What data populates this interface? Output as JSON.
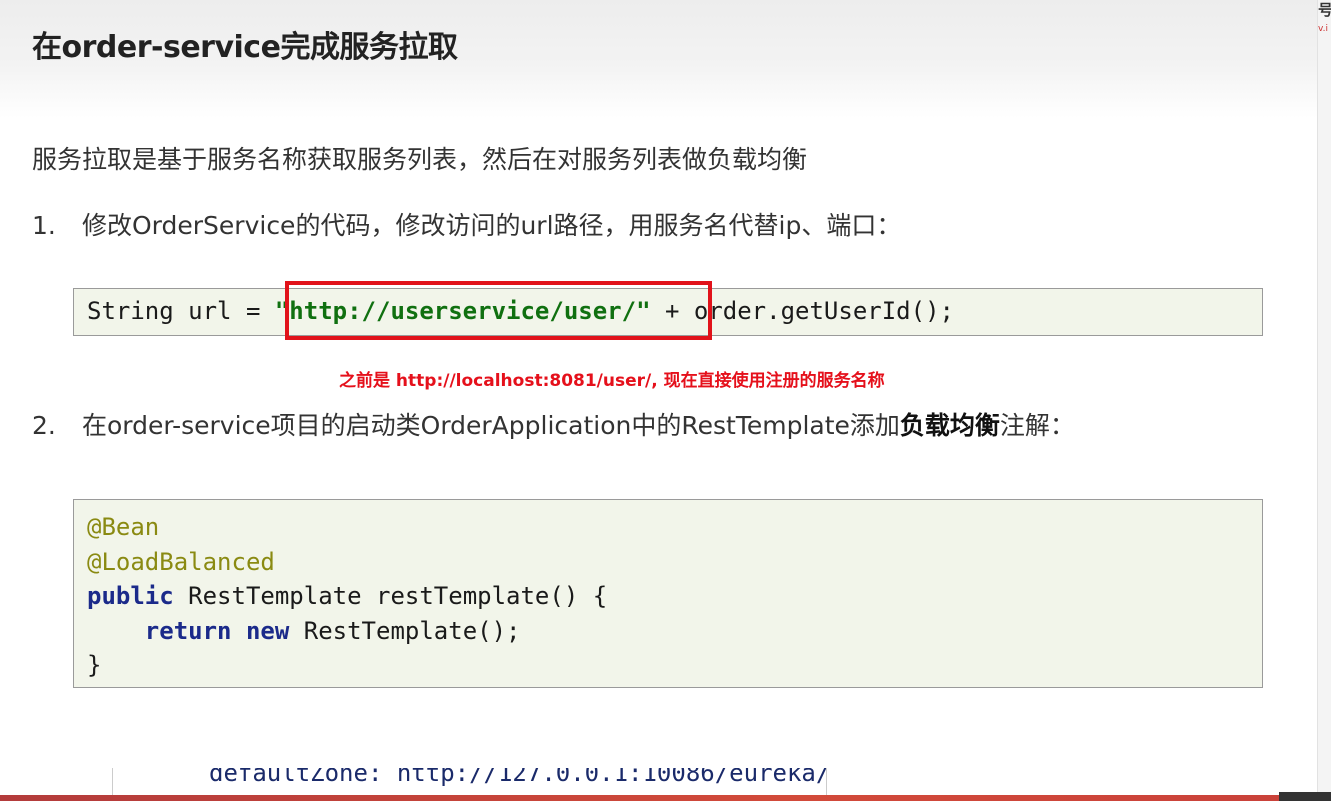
{
  "slide": {
    "title": "在order-service完成服务拉取",
    "intro": "服务拉取是基于服务名称获取服务列表，然后在对服务列表做负载均衡",
    "corner_glyph": "号",
    "corner_small": "v.i"
  },
  "steps": [
    {
      "number": "1.",
      "text": "修改OrderService的代码，修改访问的url路径，用服务名代替ip、端口："
    },
    {
      "number": "2.",
      "text_before": "在order-service项目的启动类OrderApplication中的RestTemplate添加",
      "text_bold": "负载均衡",
      "text_after": "注解："
    }
  ],
  "code_snippet_1": {
    "prefix": "String url = ",
    "url_literal": "\"http://userservice/user/\"",
    "suffix": " + order.getUserId();"
  },
  "annotation_note": "之前是 http://localhost:8081/user/, 现在直接使用注册的服务名称",
  "code_snippet_2": {
    "line1": "@Bean",
    "line2": "@LoadBalanced",
    "line3_kw": "public",
    "line3_rest": " RestTemplate restTemplate() {",
    "line4_indent": "    ",
    "line4_kw1": "return",
    "line4_kw2": "new",
    "line4_rest": " RestTemplate();",
    "line5": "}"
  },
  "bottom_code_peek": "defaultZone: http://127.0.0.1:10086/eureka/",
  "colors": {
    "highlight_border": "#e1121a",
    "note_text": "#e5101b",
    "url_literal": "#107010",
    "annotation": "#8a8a12",
    "keyword": "#1b2a8a",
    "code_bg": "#f2f5ea"
  }
}
